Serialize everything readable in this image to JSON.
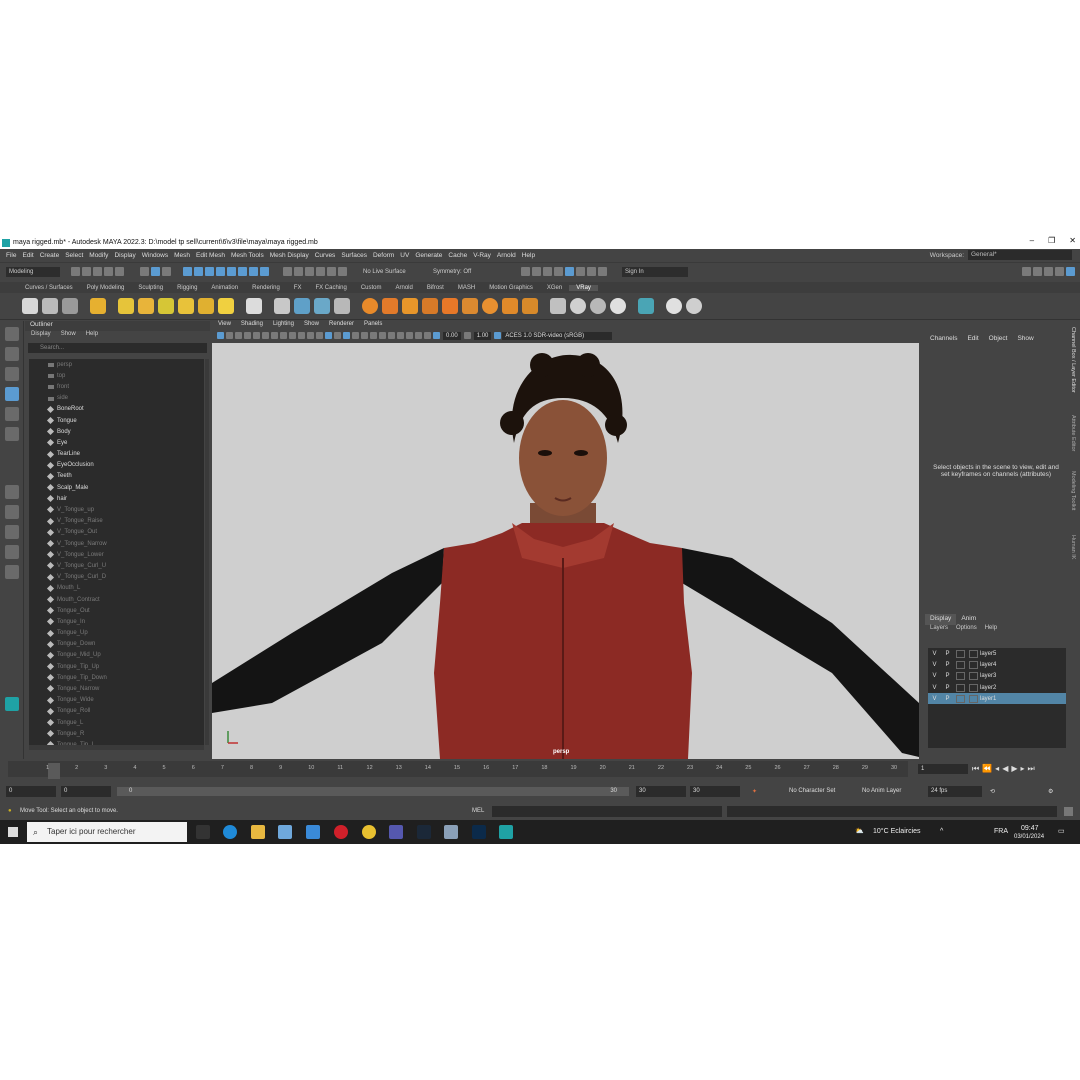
{
  "window": {
    "title": "maya rigged.mb* - Autodesk MAYA 2022.3: D:\\model tp sell\\current\\6\\v3\\file\\maya\\maya rigged.mb",
    "controls": [
      "–",
      "❐",
      "✕"
    ]
  },
  "menu": {
    "items": [
      "File",
      "Edit",
      "Create",
      "Select",
      "Modify",
      "Display",
      "Windows",
      "Mesh",
      "Edit Mesh",
      "Mesh Tools",
      "Mesh Display",
      "Curves",
      "Surfaces",
      "Deform",
      "UV",
      "Generate",
      "Cache",
      "V-Ray",
      "Arnold",
      "Help"
    ],
    "workspace_label": "Workspace:",
    "workspace_value": "General*"
  },
  "status": {
    "mode": "Modeling",
    "live_surface": "No Live Surface",
    "symmetry": "Symmetry: Off",
    "sign_in": "Sign In"
  },
  "shelf": {
    "tabs": [
      "Curves / Surfaces",
      "Poly Modeling",
      "Sculpting",
      "Rigging",
      "Animation",
      "Rendering",
      "FX",
      "FX Caching",
      "Custom",
      "Arnold",
      "Bifrost",
      "MASH",
      "Motion Graphics",
      "XGen",
      "VRay"
    ],
    "active_tab": "VRay"
  },
  "outliner": {
    "title": "Outliner",
    "menu": [
      "Display",
      "Show",
      "Help"
    ],
    "search_placeholder": "Search...",
    "items": [
      {
        "label": "persp",
        "dim": true,
        "cam": true
      },
      {
        "label": "top",
        "dim": true,
        "cam": true
      },
      {
        "label": "front",
        "dim": true,
        "cam": true
      },
      {
        "label": "side",
        "dim": true,
        "cam": true
      },
      {
        "label": "BoneRoot",
        "dim": false
      },
      {
        "label": "Tongue",
        "dim": false
      },
      {
        "label": "Body",
        "dim": false
      },
      {
        "label": "Eye",
        "dim": false
      },
      {
        "label": "TearLine",
        "dim": false
      },
      {
        "label": "EyeOcclusion",
        "dim": false
      },
      {
        "label": "Teeth",
        "dim": false
      },
      {
        "label": "Scalp_Male",
        "dim": false
      },
      {
        "label": "hair",
        "dim": false
      },
      {
        "label": "V_Tongue_up",
        "dim": true
      },
      {
        "label": "V_Tongue_Raise",
        "dim": true
      },
      {
        "label": "V_Tongue_Out",
        "dim": true
      },
      {
        "label": "V_Tongue_Narrow",
        "dim": true
      },
      {
        "label": "V_Tongue_Lower",
        "dim": true
      },
      {
        "label": "V_Tongue_Curl_U",
        "dim": true
      },
      {
        "label": "V_Tongue_Curl_D",
        "dim": true
      },
      {
        "label": "Mouth_L",
        "dim": true
      },
      {
        "label": "Mouth_Contract",
        "dim": true
      },
      {
        "label": "Tongue_Out",
        "dim": true
      },
      {
        "label": "Tongue_In",
        "dim": true
      },
      {
        "label": "Tongue_Up",
        "dim": true
      },
      {
        "label": "Tongue_Down",
        "dim": true
      },
      {
        "label": "Tongue_Mid_Up",
        "dim": true
      },
      {
        "label": "Tongue_Tip_Up",
        "dim": true
      },
      {
        "label": "Tongue_Tip_Down",
        "dim": true
      },
      {
        "label": "Tongue_Narrow",
        "dim": true
      },
      {
        "label": "Tongue_Wide",
        "dim": true
      },
      {
        "label": "Tongue_Roll",
        "dim": true
      },
      {
        "label": "Tongue_L",
        "dim": true
      },
      {
        "label": "Tongue_R",
        "dim": true
      },
      {
        "label": "Tongue_Tip_L",
        "dim": true
      }
    ]
  },
  "viewport": {
    "menu": [
      "View",
      "Shading",
      "Lighting",
      "Show",
      "Renderer",
      "Panels"
    ],
    "value_a": "0.00",
    "value_b": "1.00",
    "color_space": "ACES 1.0 SDR-video (sRGB)",
    "camera_label": "persp"
  },
  "channelbox": {
    "menu": [
      "Channels",
      "Edit",
      "Object",
      "Show"
    ],
    "message": "Select objects in the scene to view, edit and set keyframes on channels (attributes)"
  },
  "side_tabs": [
    "Channel Box / Layer Editor",
    "Attribute Editor",
    "Modeling Toolkit",
    "Human IK"
  ],
  "layers": {
    "tabs": [
      "Display",
      "Anim"
    ],
    "menu": [
      "Layers",
      "Options",
      "Help"
    ],
    "rows": [
      {
        "v": "V",
        "p": "P",
        "name": "layer5"
      },
      {
        "v": "V",
        "p": "P",
        "name": "layer4"
      },
      {
        "v": "V",
        "p": "P",
        "name": "layer3"
      },
      {
        "v": "V",
        "p": "P",
        "name": "layer2"
      },
      {
        "v": "V",
        "p": "P",
        "name": "layer1"
      }
    ],
    "selected": "layer1"
  },
  "timeslider": {
    "ticks": [
      "1",
      "2",
      "3",
      "4",
      "5",
      "6",
      "7",
      "8",
      "9",
      "10",
      "11",
      "12",
      "13",
      "14",
      "15",
      "16",
      "17",
      "18",
      "19",
      "20",
      "21",
      "22",
      "23",
      "24",
      "25",
      "26",
      "27",
      "28",
      "29",
      "30"
    ],
    "current_frame": "1"
  },
  "range": {
    "start": "0",
    "anim_start": "0",
    "bar_start": "0",
    "bar_end": "30",
    "end": "30",
    "anim_end": "30",
    "character_set": "No Character Set",
    "anim_layer": "No Anim Layer",
    "fps": "24 fps"
  },
  "cmdline": {
    "help": "Move Tool: Select an object to move.",
    "lang": "MEL"
  },
  "taskbar": {
    "search": "Taper ici pour rechercher",
    "weather": "10°C  Eclaircies",
    "lang": "FRA",
    "time": "09:47",
    "date": "03/01/2024"
  }
}
